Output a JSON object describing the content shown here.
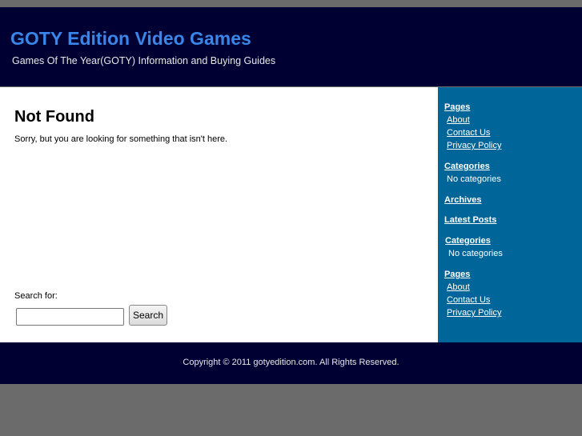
{
  "header": {
    "title": "GOTY Edition Video Games",
    "tagline": "Games Of The Year(GOTY) Information and Buying Guides"
  },
  "main": {
    "heading": "Not Found",
    "message": "Sorry, but you are looking for something that isn't here.",
    "search_label": "Search for:",
    "search_value": "",
    "search_button": "Search"
  },
  "sidebar": {
    "pages1": {
      "heading": "Pages",
      "items": [
        "About",
        "Contact Us",
        "Privacy Policy"
      ]
    },
    "categories1": {
      "heading": "Categories",
      "empty": "No categories"
    },
    "archives": {
      "heading": "Archives"
    },
    "latest": {
      "heading": "Latest Posts"
    },
    "categories2": {
      "heading": "Categories",
      "empty": "No categories"
    },
    "pages2": {
      "heading": "Pages",
      "items": [
        "About",
        "Contact Us",
        "Privacy Policy"
      ]
    }
  },
  "footer": {
    "copyright": "Copyright © 2011 gotyedition.com. All Rights Reserved."
  },
  "colors": {
    "header_bg": "#000033",
    "title": "#3a86e8",
    "sidebar_bg": "#006699",
    "outer": "#6b6b6b"
  }
}
